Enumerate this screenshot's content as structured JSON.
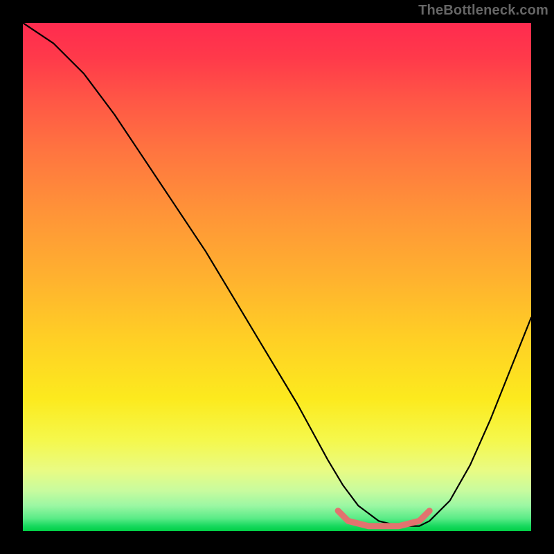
{
  "watermark": "TheBottleneck.com",
  "chart_data": {
    "type": "line",
    "title": "",
    "xlabel": "",
    "ylabel": "",
    "xlim": [
      0,
      100
    ],
    "ylim": [
      0,
      100
    ],
    "series": [
      {
        "name": "black-curve",
        "x": [
          0,
          6,
          12,
          18,
          24,
          30,
          36,
          42,
          48,
          54,
          60,
          63,
          66,
          70,
          74,
          78,
          80,
          84,
          88,
          92,
          96,
          100
        ],
        "values": [
          100,
          96,
          90,
          82,
          73,
          64,
          55,
          45,
          35,
          25,
          14,
          9,
          5,
          2,
          1,
          1,
          2,
          6,
          13,
          22,
          32,
          42
        ]
      },
      {
        "name": "red-flat-segment",
        "x": [
          62,
          64,
          66,
          68,
          70,
          72,
          74,
          76,
          78,
          80
        ],
        "values": [
          4,
          2,
          1.5,
          1,
          1,
          1,
          1,
          1.5,
          2,
          4
        ]
      }
    ],
    "annotations": [],
    "legend": []
  },
  "colors": {
    "curve_main": "#000000",
    "curve_highlight": "#e2736f",
    "gradient_top": "#ff2b4f",
    "gradient_bottom": "#00cf45",
    "frame": "#000000",
    "watermark": "#666666"
  }
}
